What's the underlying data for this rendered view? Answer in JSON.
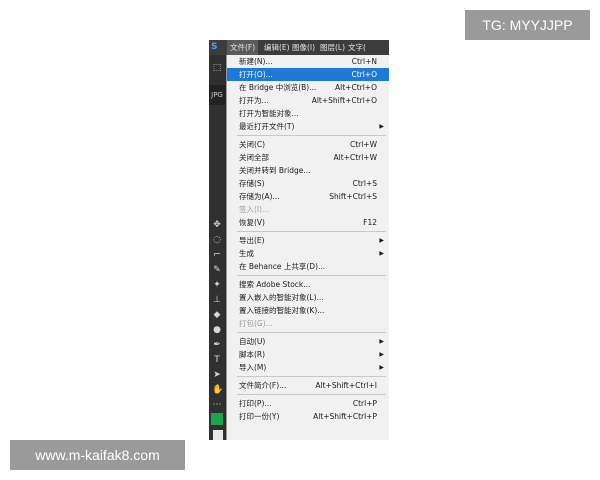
{
  "watermarks": {
    "tg": "TG: MYYJJPP",
    "site": "www.m-kaifak8.com"
  },
  "app": {
    "logo": "S",
    "left_tab": "JPG",
    "menubar": [
      {
        "label": "文件(F)",
        "active": true
      },
      {
        "label": "编辑(E)",
        "active": false
      },
      {
        "label": "图像(I)",
        "active": false
      },
      {
        "label": "图层(L)",
        "active": false
      },
      {
        "label": "文字(",
        "active": false
      }
    ],
    "colors": {
      "highlight": "#1e78d8",
      "foreground_swatch": "#1aa64a",
      "menu_bg": "#f1f1f1",
      "chrome_bg": "#3c3c3c"
    }
  },
  "file_menu": {
    "groups": [
      [
        {
          "label": "新建(N)...",
          "shortcut": "Ctrl+N"
        },
        {
          "label": "打开(O)...",
          "shortcut": "Ctrl+O",
          "highlighted": true
        },
        {
          "label": "在 Bridge 中浏览(B)...",
          "shortcut": "Alt+Ctrl+O"
        },
        {
          "label": "打开为...",
          "shortcut": "Alt+Shift+Ctrl+O"
        },
        {
          "label": "打开为智能对象...",
          "shortcut": ""
        },
        {
          "label": "最近打开文件(T)",
          "shortcut": "",
          "submenu": true
        }
      ],
      [
        {
          "label": "关闭(C)",
          "shortcut": "Ctrl+W"
        },
        {
          "label": "关闭全部",
          "shortcut": "Alt+Ctrl+W"
        },
        {
          "label": "关闭并转到 Bridge...",
          "shortcut": ""
        },
        {
          "label": "存储(S)",
          "shortcut": "Ctrl+S"
        },
        {
          "label": "存储为(A)...",
          "shortcut": "Shift+Ctrl+S"
        },
        {
          "label": "签入(I)...",
          "shortcut": "",
          "disabled": true
        },
        {
          "label": "恢复(V)",
          "shortcut": "F12"
        }
      ],
      [
        {
          "label": "导出(E)",
          "shortcut": "",
          "submenu": true
        },
        {
          "label": "生成",
          "shortcut": "",
          "submenu": true
        },
        {
          "label": "在 Behance 上共享(D)...",
          "shortcut": ""
        }
      ],
      [
        {
          "label": "搜索 Adobe Stock...",
          "shortcut": ""
        },
        {
          "label": "置入嵌入的智能对象(L)...",
          "shortcut": ""
        },
        {
          "label": "置入链接的智能对象(K)...",
          "shortcut": ""
        },
        {
          "label": "打包(G)...",
          "shortcut": "",
          "disabled": true
        }
      ],
      [
        {
          "label": "自动(U)",
          "shortcut": "",
          "submenu": true
        },
        {
          "label": "脚本(R)",
          "shortcut": "",
          "submenu": true
        },
        {
          "label": "导入(M)",
          "shortcut": "",
          "submenu": true
        }
      ],
      [
        {
          "label": "文件简介(F)...",
          "shortcut": "Alt+Shift+Ctrl+I"
        }
      ],
      [
        {
          "label": "打印(P)...",
          "shortcut": "Ctrl+P"
        },
        {
          "label": "打印一份(Y)",
          "shortcut": "Alt+Shift+Ctrl+P"
        }
      ]
    ]
  }
}
